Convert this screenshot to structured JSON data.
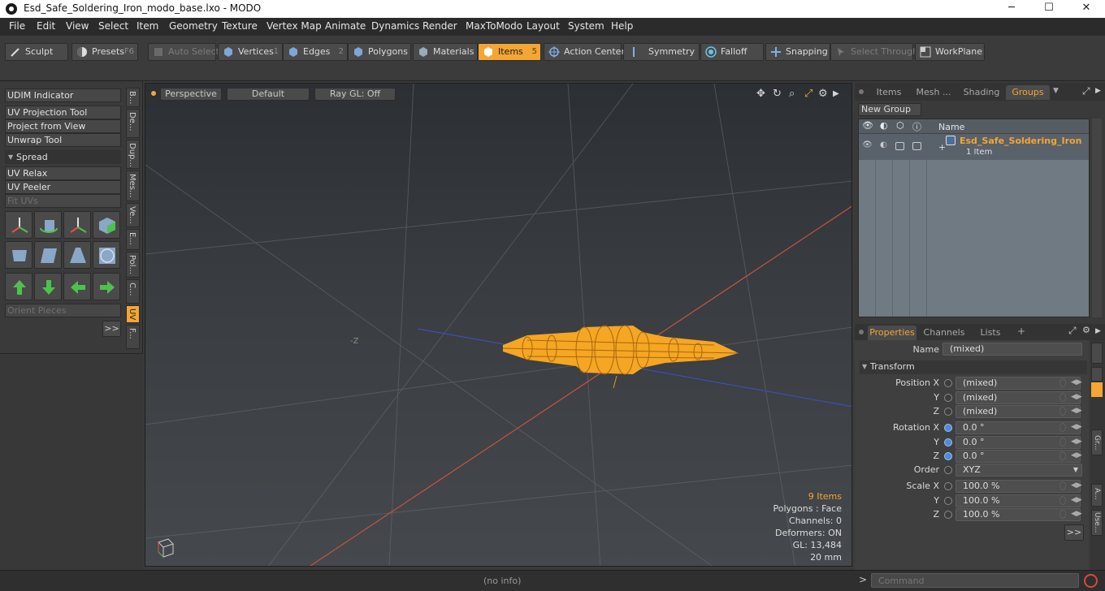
{
  "window": {
    "title": "Esd_Safe_Soldering_Iron_modo_base.lxo - MODO",
    "minimize": "─",
    "maximize": "☐",
    "close": "✕"
  },
  "menu": [
    "File",
    "Edit",
    "View",
    "Select",
    "Item",
    "Geometry",
    "Texture",
    "Vertex Map",
    "Animate",
    "Dynamics",
    "Render",
    "MaxToModo",
    "Layout",
    "System",
    "Help"
  ],
  "toolbar": {
    "sculpt": "Sculpt",
    "presets": "Presets",
    "presets_key": "F6",
    "auto_select": "Auto Select",
    "vertices": "Vertices",
    "vertices_num": "1",
    "edges": "Edges",
    "edges_num": "2",
    "polygons": "Polygons",
    "materials": "Materials",
    "items": "Items",
    "items_num": "5",
    "action_center": "Action Center",
    "symmetry": "Symmetry",
    "falloff": "Falloff",
    "snapping": "Snapping",
    "select_through": "Select Through",
    "workplane": "WorkPlane"
  },
  "left_tools": {
    "udim": "UDIM Indicator",
    "uv_projection": "UV Projection Tool",
    "project_view": "Project from View",
    "unwrap": "Unwrap Tool",
    "spread": "Spread",
    "uv_relax": "UV Relax",
    "uv_peeler": "UV Peeler",
    "fit_uvs": "Fit UVs",
    "orient": "Orient Pieces",
    "more": ">>"
  },
  "side_tabs": [
    "B...",
    "De...",
    "Dup...",
    "Mes...",
    "Ve...",
    "E...",
    "Pol...",
    "C...",
    "UV",
    "F..."
  ],
  "viewport": {
    "view": "Perspective",
    "shading": "Default",
    "raygl": "Ray GL: Off",
    "axis_label": "-Z",
    "hud": {
      "items": "9 Items",
      "polygons": "Polygons : Face",
      "channels": "Channels: 0",
      "deformers": "Deformers: ON",
      "gl": "GL: 13,484",
      "scale": "20 mm"
    }
  },
  "right_top": {
    "tabs": [
      "Items",
      "Mesh ...",
      "Shading",
      "Groups"
    ],
    "new_group": "New Group",
    "col_name": "Name",
    "group_name": "Esd_Safe_Soldering_Iron",
    "group_count": "1 Item"
  },
  "properties": {
    "tabs": [
      "Properties",
      "Channels",
      "Lists"
    ],
    "add_tab": "+",
    "name_label": "Name",
    "name_value": "(mixed)",
    "transform": "Transform",
    "pos_x_label": "Position X",
    "pos_y_label": "Y",
    "pos_z_label": "Z",
    "pos_x": "(mixed)",
    "pos_y": "(mixed)",
    "pos_z": "(mixed)",
    "rot_x_label": "Rotation X",
    "rot_y_label": "Y",
    "rot_z_label": "Z",
    "rot_x": "0.0 °",
    "rot_y": "0.0 °",
    "rot_z": "0.0 °",
    "order_label": "Order",
    "order": "XYZ",
    "scale_x_label": "Scale X",
    "scale_y_label": "Y",
    "scale_z_label": "Z",
    "scale_x": "100.0 %",
    "scale_y": "100.0 %",
    "scale_z": "100.0 %",
    "more": ">>",
    "side_tabs": [
      "Gr...",
      "A...",
      "Use..."
    ]
  },
  "status": {
    "info": "(no info)",
    "prompt": ">",
    "command_placeholder": "Command"
  },
  "colors": {
    "accent": "#f3a634",
    "mesh": "#f5a623",
    "x_axis": "#c8533f",
    "z_axis": "#3c4fb0"
  }
}
